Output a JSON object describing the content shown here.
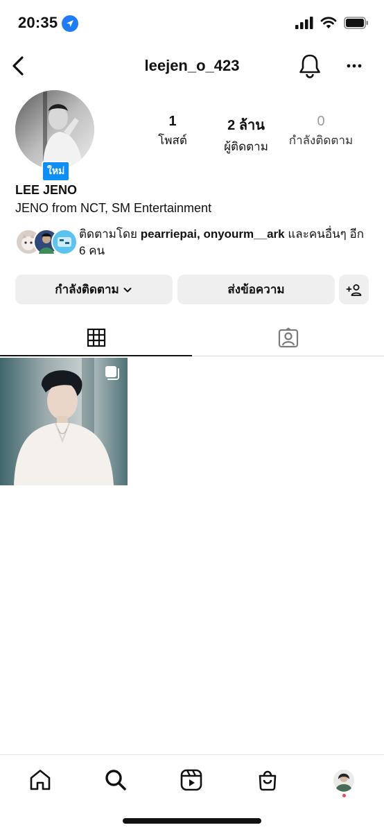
{
  "status_bar": {
    "time": "20:35"
  },
  "header": {
    "username": "leejen_o_423"
  },
  "profile": {
    "new_badge": "ใหม่",
    "stats": [
      {
        "value": "1",
        "label": "โพสต์"
      },
      {
        "value": "2 ล้าน",
        "label": "ผู้ติดตาม"
      },
      {
        "value": "0",
        "label": "กำลังติดตาม"
      }
    ],
    "name": "LEE JENO",
    "bio": "JENO from NCT, SM Entertainment",
    "followed_by": {
      "prefix": "ติดตามโดย ",
      "users": "pearriepai, onyourm__ark",
      "suffix": " และคนอื่นๆ อีก 6 คน"
    }
  },
  "actions": {
    "following_label": "กำลังติดตาม",
    "message_label": "ส่งข้อความ"
  },
  "tabs": [
    "posts-grid",
    "tagged"
  ],
  "colors": {
    "accent": "#0f8ef5",
    "button_bg": "#efefef",
    "notification_dot": "#ed4956"
  }
}
